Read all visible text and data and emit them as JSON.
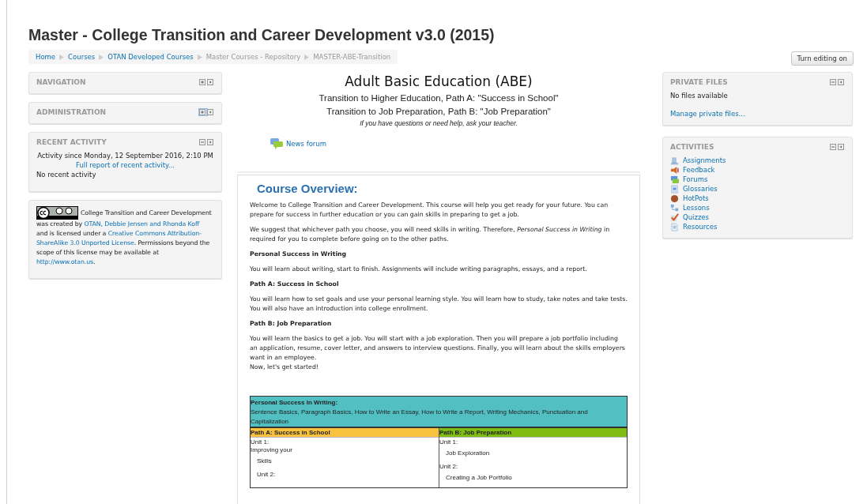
{
  "page_title": "Master - College Transition and Career Development v3.0 (2015)",
  "breadcrumb": [
    {
      "label": "Home",
      "link": true
    },
    {
      "label": "Courses",
      "link": true
    },
    {
      "label": "OTAN Developed Courses",
      "link": true
    },
    {
      "label": "Master Courses - Repository",
      "link": false
    },
    {
      "label": "MASTER-ABE-Transition",
      "link": false
    }
  ],
  "edit_button": "Turn editing on",
  "left_blocks": [
    {
      "kind": "header",
      "title": "NAVIGATION",
      "collapsed": true,
      "focused": false
    },
    {
      "kind": "header",
      "title": "ADMINISTRATION",
      "collapsed": true,
      "focused": true
    },
    {
      "kind": "recent",
      "title": "RECENT ACTIVITY",
      "collapsed": false,
      "focused": false,
      "since": "Activity since Monday, 12 September 2016, 2:10 PM",
      "report_link": "Full report of recent activity...",
      "empty": "No recent activity"
    },
    {
      "kind": "license",
      "lines": [
        [
          {
            "kind": "text",
            "text": "College Transition and Career Development"
          }
        ],
        [
          {
            "kind": "text",
            "text": "was created by "
          },
          {
            "kind": "link",
            "text": "OTAN, Debbie Jensen and Rhonda Koff"
          }
        ],
        [
          {
            "kind": "text",
            "text": "and is licensed under a "
          },
          {
            "kind": "link",
            "text": "Creative Commons Attribution-"
          }
        ],
        [
          {
            "kind": "link",
            "text": "ShareAlike 3.0 Unported License"
          },
          {
            "kind": "text",
            "text": ". Permissions beyond the"
          }
        ],
        [
          {
            "kind": "text",
            "text": "scope of this license may be available at"
          }
        ],
        [
          {
            "kind": "link",
            "text": "http://www.otan.us"
          },
          {
            "kind": "text",
            "text": "."
          }
        ]
      ]
    }
  ],
  "course_header": {
    "title": "Adult Basic Education (ABE)",
    "subtitles": [
      "Transition to Higher Education, Path A: \"Success in School\"",
      "Transition to Job Preparation, Path B: \"Job Preparation\""
    ],
    "note": "If you have questions or need help, ask your teacher."
  },
  "news_forum": "News forum",
  "overview": {
    "heading": "Course Overview:",
    "blocks": [
      {
        "kind": "para",
        "text": "Welcome to College Transition and Career Development.  This course will help you get ready for your future.  You can prepare for success in further education or you can gain skills in preparing to get a job."
      },
      {
        "kind": "para",
        "text": "We suggest that whichever path you choose, you will need skills in writing. Therefore, *Personal Success in Writing* in required for you to complete before going on to the other paths."
      },
      {
        "kind": "heading",
        "text": "Personal Success in Writing"
      },
      {
        "kind": "para",
        "text": "You will learn about writing, start to finish. Assignments will include writing paragraphs, essays, and a report."
      },
      {
        "kind": "heading",
        "text": "Path A: Success in School"
      },
      {
        "kind": "para",
        "text": "You will learn how to set goals and use your personal learning style.  You will learn how to study, take notes and take tests.  You will also have an introduction into college enrollment."
      },
      {
        "kind": "heading",
        "text": "Path B: Job Preparation"
      },
      {
        "kind": "para",
        "text": "You will learn the basics to get a job. You will start with a job exploration. Then you will prepare a job portfolio including an application, resume, cover letter, and answers to interview questions.  Finally, you will learn about the skills employers want in an employee."
      },
      {
        "kind": "line",
        "text": "Now, let's get started!"
      }
    ],
    "table": {
      "top": {
        "title": "Personal Success In Writing:",
        "text": "Sentence Basics, Paragraph Basics, How to Write an Essay, How to Write a Report, Writing Mechanics, Punctuation and Capitalization",
        "color": "#52c0c3"
      },
      "columns": [
        {
          "title": "Path A: Success in School",
          "color": "#f8c23e",
          "lines": [
            {
              "text": "Unit 1:",
              "indent": false
            },
            {
              "text": "Improving your",
              "indent": false
            },
            {
              "text": "Skills",
              "indent": true
            },
            {
              "text": "Unit 2:",
              "indent": true
            }
          ]
        },
        {
          "title": "Path B: Job Preparation",
          "color": "#7fbd13",
          "lines": [
            {
              "text": "Unit 1:",
              "indent": false
            },
            {
              "text": "Job Exploration",
              "indent": true
            },
            {
              "text": "Unit 2:",
              "indent": false
            },
            {
              "text": "Creating a Job Portfolio",
              "indent": true
            }
          ]
        }
      ]
    }
  },
  "right_blocks": [
    {
      "kind": "files",
      "title": "PRIVATE FILES",
      "empty": "No files available",
      "link": "Manage private files..."
    },
    {
      "kind": "activities",
      "title": "ACTIVITIES",
      "items": [
        "Assignments",
        "Feedback",
        "Forums",
        "Glossaries",
        "HotPots",
        "Lessons",
        "Quizzes",
        "Resources"
      ]
    }
  ]
}
